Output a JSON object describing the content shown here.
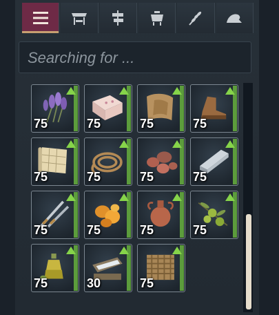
{
  "tabs": [
    {
      "icon": "menu-lines-icon",
      "active": true
    },
    {
      "icon": "market-stall-icon",
      "active": false
    },
    {
      "icon": "signpost-icon",
      "active": false
    },
    {
      "icon": "cooking-pot-icon",
      "active": false
    },
    {
      "icon": "wheat-icon",
      "active": false
    },
    {
      "icon": "wave-icon",
      "active": false
    }
  ],
  "search": {
    "placeholder": "Searching for ..."
  },
  "items": [
    {
      "name": "lavender",
      "qty": "75"
    },
    {
      "name": "soap",
      "qty": "75"
    },
    {
      "name": "leather",
      "qty": "75"
    },
    {
      "name": "boots",
      "qty": "75"
    },
    {
      "name": "parchment",
      "qty": "75"
    },
    {
      "name": "rope",
      "qty": "75"
    },
    {
      "name": "ore",
      "qty": "75"
    },
    {
      "name": "iron-ingot",
      "qty": "75"
    },
    {
      "name": "swords",
      "qty": "75"
    },
    {
      "name": "amber",
      "qty": "75"
    },
    {
      "name": "amphora",
      "qty": "75"
    },
    {
      "name": "olives",
      "qty": "75"
    },
    {
      "name": "olive-oil",
      "qty": "75"
    },
    {
      "name": "salt",
      "qty": "30"
    },
    {
      "name": "wicker",
      "qty": "75"
    }
  ],
  "colors": {
    "accent": "#6e2a46",
    "upgrade": "#86d44a",
    "stockbar": "#5c9c3c"
  }
}
